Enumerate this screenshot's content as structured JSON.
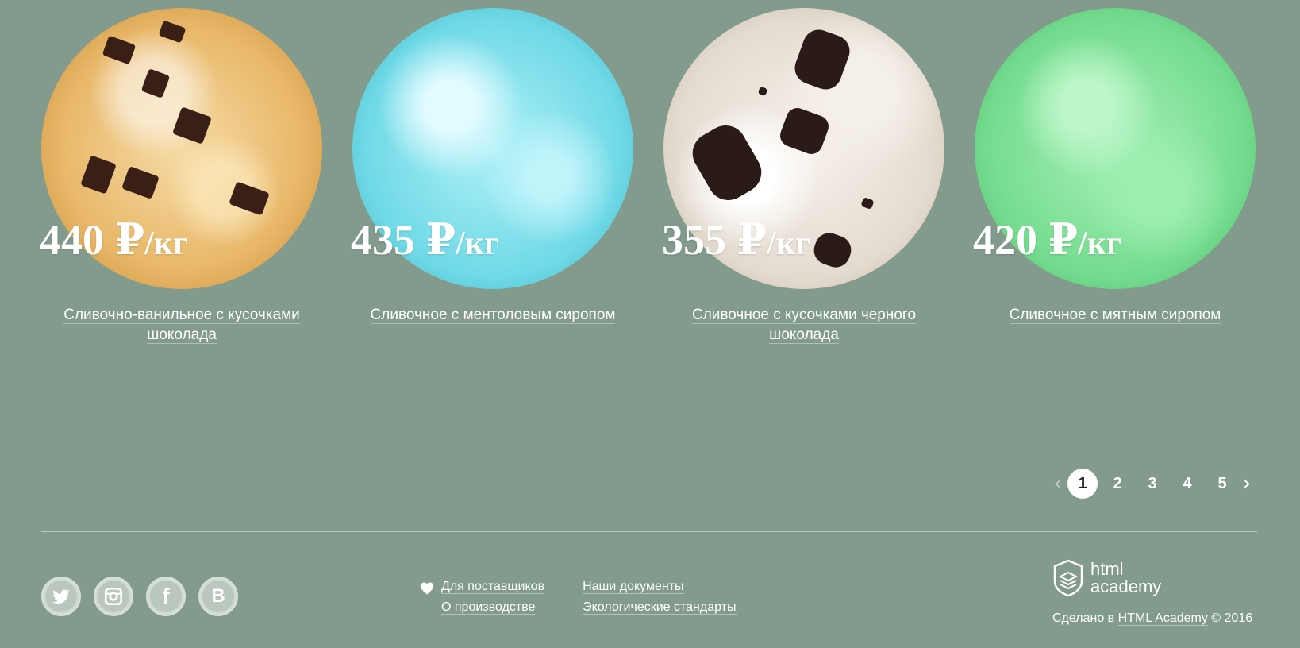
{
  "products": [
    {
      "price": "440 ₽",
      "unit": "/кг",
      "name": "Сливочно-ванильное с кусочками шоколада"
    },
    {
      "price": "435 ₽",
      "unit": "/кг",
      "name": "Сливочное с ментоловым сиропом"
    },
    {
      "price": "355 ₽",
      "unit": "/кг",
      "name": "Сливочное с кусочками черного шоколада"
    },
    {
      "price": "420 ₽",
      "unit": "/кг",
      "name": "Сливочное с мятным сиропом"
    }
  ],
  "pagination": {
    "prev": "‹",
    "next": "›",
    "pages": [
      "1",
      "2",
      "3",
      "4",
      "5"
    ],
    "current": "1"
  },
  "footer": {
    "social": {
      "twitter": "twitter-icon",
      "instagram": "instagram-icon",
      "facebook": "f",
      "vk": "B"
    },
    "links_col1": [
      "Для поставщиков",
      "О производстве"
    ],
    "links_col2": [
      "Наши документы",
      "Экологические стандарты"
    ],
    "academy_line1": "html",
    "academy_line2": "academy",
    "copyright_prefix": "Сделано в ",
    "copyright_link": "HTML Academy",
    "copyright_suffix": " © 2016"
  },
  "colors": {
    "background": "#829b8d",
    "text": "#ffffff",
    "active_page_bg": "#ffffff"
  }
}
